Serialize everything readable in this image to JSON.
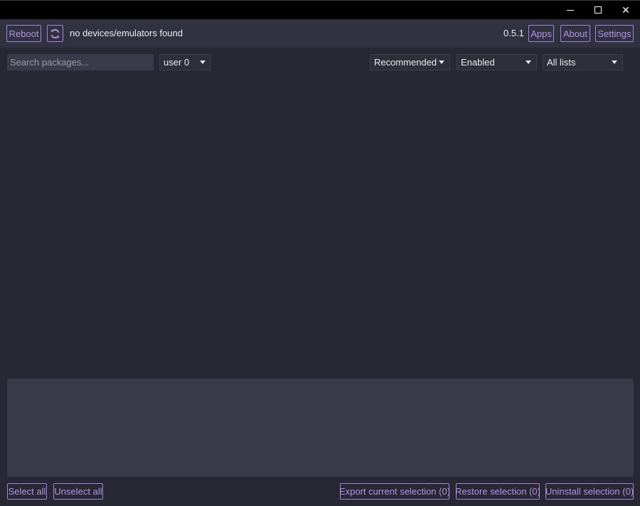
{
  "window": {
    "controls": {
      "minimize_icon": "minimize-icon",
      "maximize_icon": "maximize-icon",
      "close_icon": "close-icon",
      "close_glyph": "✕"
    }
  },
  "toolbar": {
    "reboot_label": "Reboot",
    "refresh_icon": "refresh-icon",
    "status": "no devices/emulators found",
    "version": "0.5.1",
    "apps_label": "Apps",
    "about_label": "About",
    "settings_label": "Settings"
  },
  "filters": {
    "search_placeholder": "Search packages...",
    "search_value": "",
    "user_select": "user 0",
    "removal_select": "Recommended",
    "state_select": "Enabled",
    "list_select": "All lists"
  },
  "package_list": {
    "items": []
  },
  "description": {
    "text": ""
  },
  "bottom": {
    "select_all_label": "Select all",
    "unselect_all_label": "Unselect all",
    "export_label": "Export current selection (0)",
    "restore_label": "Restore selection (0)",
    "uninstall_label": "Uninstall selection (0)"
  },
  "colors": {
    "background": "#272833",
    "toolbar": "#313240",
    "accent": "#a97fe0",
    "panel": "#393a4a"
  }
}
